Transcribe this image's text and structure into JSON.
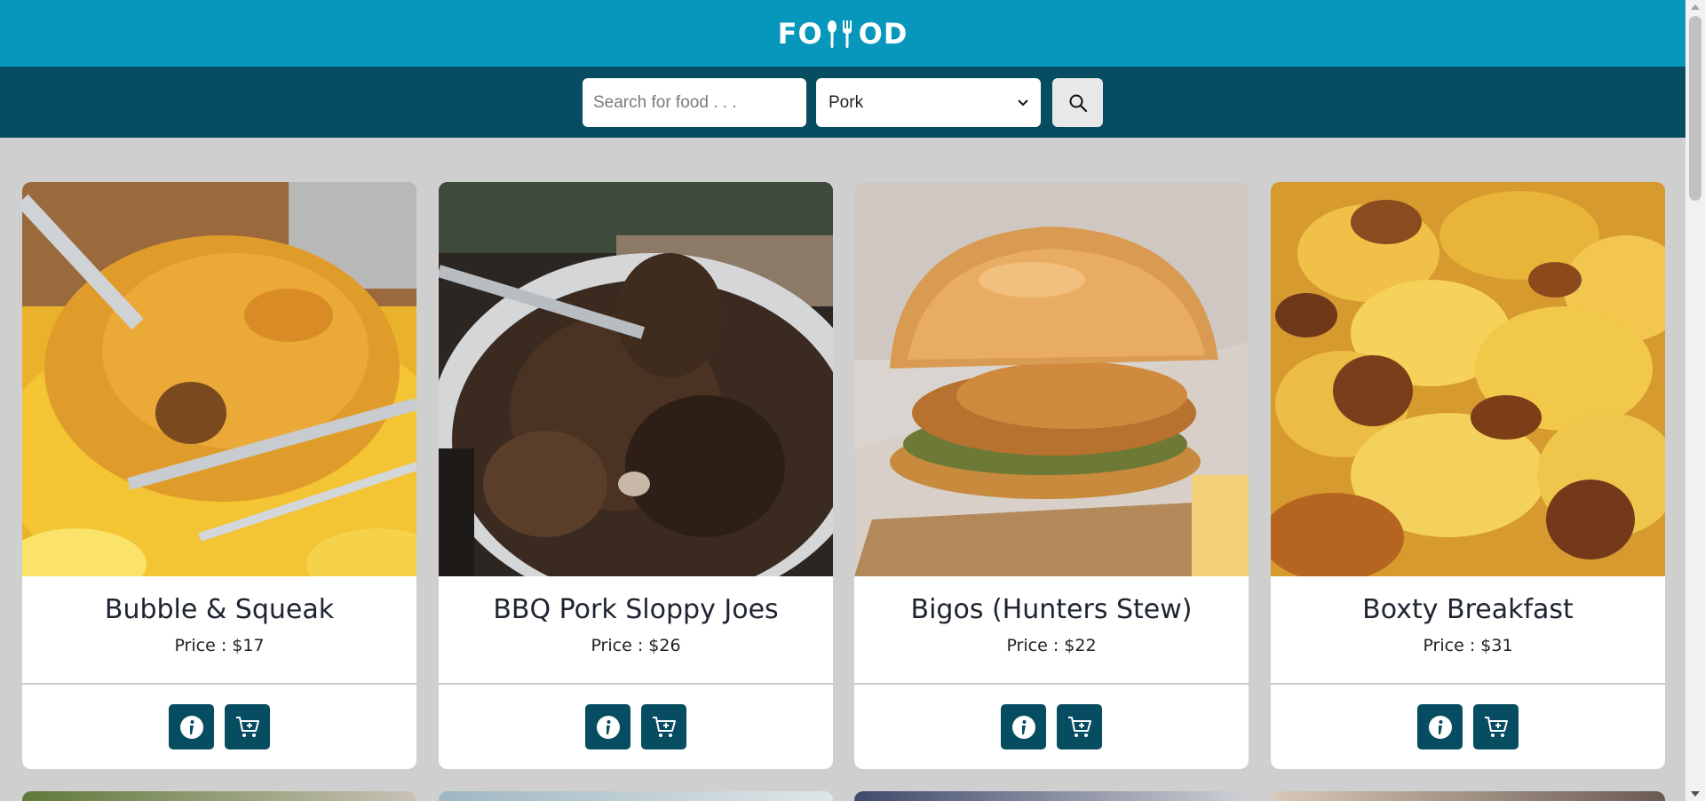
{
  "brand": {
    "logo_text_left": "FO",
    "logo_text_right": "OD",
    "logo_icon": "fork-spoon-icon",
    "header_color": "#0897bc",
    "searchbar_color": "#074d61",
    "button_color": "#074d61"
  },
  "search": {
    "placeholder": "Search for food . . .",
    "value": "",
    "category_selected": "Pork",
    "search_icon": "search-icon"
  },
  "cards": [
    {
      "title": "Bubble & Squeak",
      "price": "Price : $17",
      "info_icon": "info-icon",
      "cart_icon": "add-to-cart-icon"
    },
    {
      "title": "BBQ Pork Sloppy Joes",
      "price": "Price : $26",
      "info_icon": "info-icon",
      "cart_icon": "add-to-cart-icon"
    },
    {
      "title": "Bigos (Hunters Stew)",
      "price": "Price : $22",
      "info_icon": "info-icon",
      "cart_icon": "add-to-cart-icon"
    },
    {
      "title": "Boxty Breakfast",
      "price": "Price : $31",
      "info_icon": "info-icon",
      "cart_icon": "add-to-cart-icon"
    }
  ]
}
